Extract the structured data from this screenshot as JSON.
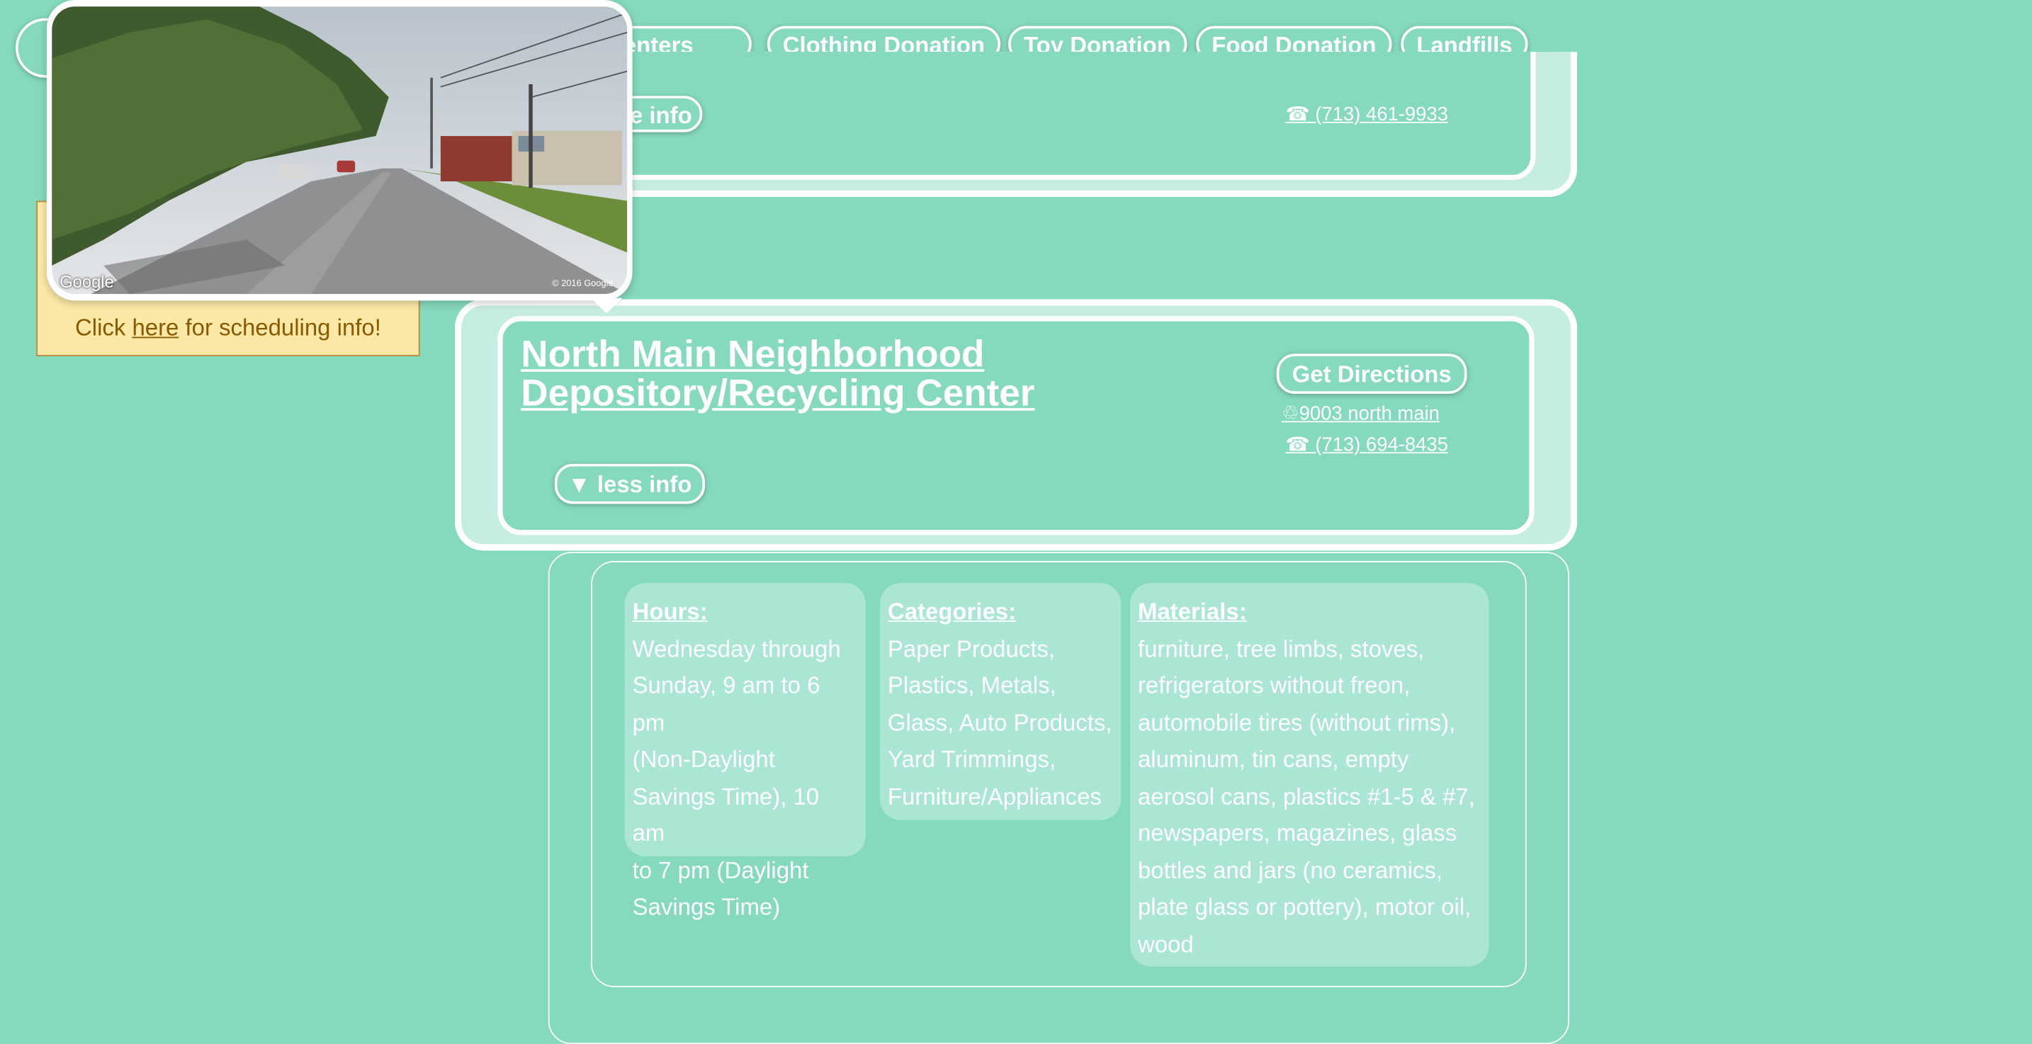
{
  "nav": {
    "items": [
      {
        "label": "Recycling Centers",
        "visible": "g Centers"
      },
      {
        "label": "Clothing Donation"
      },
      {
        "label": "Toy Donation"
      },
      {
        "label": "Food Donation"
      },
      {
        "label": "Landfills"
      }
    ]
  },
  "prev_listing": {
    "more_info_visible": "e info",
    "phone": "☎ (713) 461-9933"
  },
  "streetview": {
    "google_label": "Google",
    "copyright": "© 2016 Google"
  },
  "schedule_note": {
    "prefix": "Click ",
    "link": "here",
    "suffix": " for scheduling info!"
  },
  "listing": {
    "title_line1": "North Main Neighborhood",
    "title_line2": "Depository/Recycling Center",
    "directions_label": "Get Directions",
    "address": "♲9003 north main ",
    "phone": "☎ (713) 694-8435",
    "less_info_label": "▼ less info"
  },
  "details": {
    "hours": {
      "heading": "Hours:",
      "lines": [
        "Wednesday through",
        "Sunday, 9 am to 6 pm",
        "(Non-Daylight",
        "Savings Time), 10 am",
        "to 7 pm (Daylight",
        "Savings Time)"
      ]
    },
    "categories": {
      "heading": "Categories:",
      "lines": [
        "Paper Products,",
        "Plastics, Metals,",
        "Glass, Auto Products,",
        "Yard Trimmings,",
        "Furniture/Appliances"
      ]
    },
    "materials": {
      "heading": "Materials:",
      "lines": [
        "furniture, tree limbs, stoves,",
        "refrigerators without freon,",
        "automobile tires (without rims),",
        "aluminum, tin cans, empty",
        "aerosol cans, plastics #1-5 & #7,",
        "newspapers, magazines, glass",
        "bottles and jars (no ceramics,",
        "plate glass or pottery), motor oil,",
        "wood"
      ]
    }
  },
  "colors": {
    "background": "#85d9bd",
    "card_outer": "#c6ede1",
    "detail_box": "#aae6d3",
    "note_bg": "#fbe8a6",
    "note_text": "#8a5a00"
  }
}
